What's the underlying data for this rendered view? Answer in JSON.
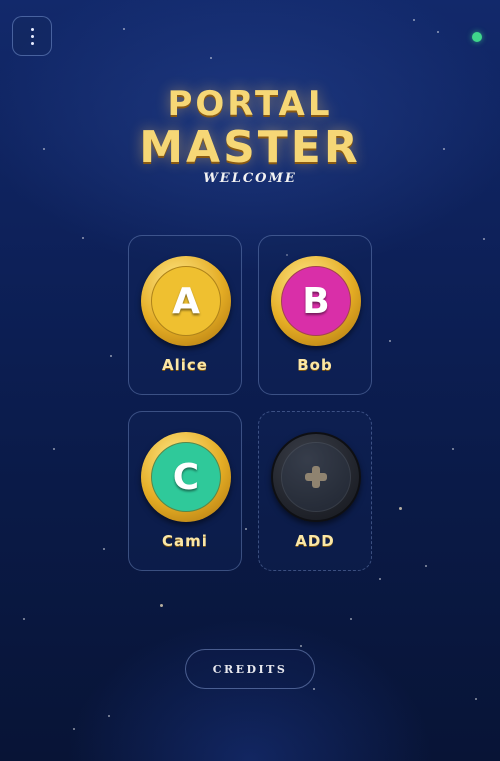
{
  "header": {
    "menu_icon": "vertical-ellipsis-icon",
    "status_color": "#3fd68b"
  },
  "title": {
    "line1": "PORTAL",
    "line2": "MASTER",
    "subtitle": "WELCOME"
  },
  "profiles": [
    {
      "initial": "A",
      "name": "Alice",
      "color": "#efc030"
    },
    {
      "initial": "B",
      "name": "Bob",
      "color": "#d92fa8"
    },
    {
      "initial": "C",
      "name": "Cami",
      "color": "#2fc99a"
    }
  ],
  "add_profile": {
    "label": "ADD",
    "icon": "plus-icon"
  },
  "footer": {
    "credits_label": "CREDITS"
  },
  "colors": {
    "gold": "#f6d776",
    "background": "#0d2058"
  }
}
